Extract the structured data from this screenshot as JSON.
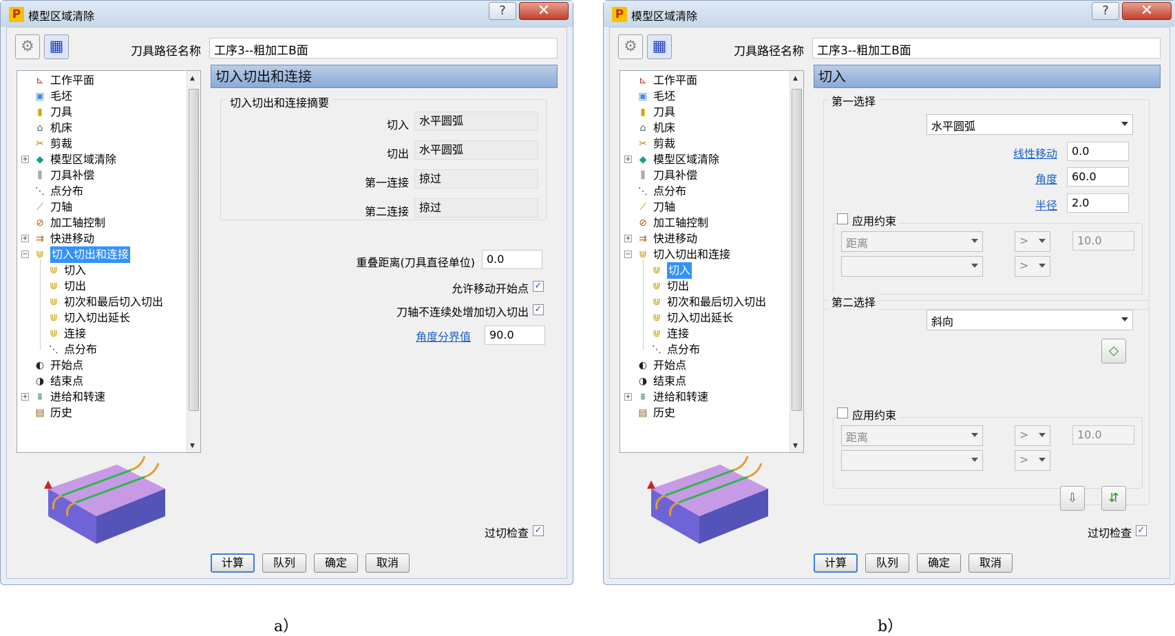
{
  "window_title": "模型区域清除",
  "app_icon": "P",
  "help_label": "?",
  "close_label": "✕",
  "path_label": "刀具路径名称",
  "path_value": "工序3--粗加工B面",
  "tree": {
    "items": [
      {
        "label": "工作平面",
        "icon": "workplane-icon"
      },
      {
        "label": "毛坯",
        "icon": "block-icon"
      },
      {
        "label": "刀具",
        "icon": "tool-icon"
      },
      {
        "label": "机床",
        "icon": "machine-icon"
      },
      {
        "label": "剪裁",
        "icon": "limit-icon"
      },
      {
        "label": "模型区域清除",
        "icon": "area-clearance-icon"
      },
      {
        "label": "刀具补偿",
        "icon": "tool-compensation-icon"
      },
      {
        "label": "点分布",
        "icon": "point-distribution-icon"
      },
      {
        "label": "刀轴",
        "icon": "tool-axis-icon"
      },
      {
        "label": "加工轴控制",
        "icon": "axis-control-icon"
      },
      {
        "label": "快进移动",
        "icon": "rapid-move-icon"
      },
      {
        "label": "切入切出和连接",
        "icon": "leads-links-icon"
      },
      {
        "label": "切入",
        "icon": "lead-in-icon"
      },
      {
        "label": "切出",
        "icon": "lead-out-icon"
      },
      {
        "label": "初次和最后切入切出",
        "icon": "first-last-leads-icon"
      },
      {
        "label": "切入切出延长",
        "icon": "lead-extension-icon"
      },
      {
        "label": "连接",
        "icon": "links-icon"
      },
      {
        "label": "点分布",
        "icon": "point-distribution-icon"
      },
      {
        "label": "开始点",
        "icon": "start-point-icon"
      },
      {
        "label": "结束点",
        "icon": "end-point-icon"
      },
      {
        "label": "进给和转速",
        "icon": "feeds-speeds-icon"
      },
      {
        "label": "历史",
        "icon": "history-icon"
      }
    ]
  },
  "buttons": {
    "calc": "计算",
    "queue": "队列",
    "ok": "确定",
    "cancel": "取消"
  },
  "gouge_check_label": "过切检查",
  "panel_a": {
    "header": "切入切出和连接",
    "summary_title": "切入切出和连接摘要",
    "summary": [
      {
        "label": "切入",
        "value": "水平圆弧"
      },
      {
        "label": "切出",
        "value": "水平圆弧"
      },
      {
        "label": "第一连接",
        "value": "掠过"
      },
      {
        "label": "第二连接",
        "value": "掠过"
      }
    ],
    "overlap_label": "重叠距离(刀具直径单位)",
    "overlap_value": "0.0",
    "allow_move_start_label": "允许移动开始点",
    "add_leads_label": "刀轴不连续处增加切入切出",
    "angle_threshold_label": "角度分界值",
    "angle_threshold_value": "90.0"
  },
  "panel_b": {
    "header": "切入",
    "first_choice_title": "第一选择",
    "first_choice_value": "水平圆弧",
    "linear_move_label": "线性移动",
    "linear_move_value": "0.0",
    "angle_label": "角度",
    "angle_value": "60.0",
    "radius_label": "半径",
    "radius_value": "2.0",
    "apply_constraint_label": "应用约束",
    "distance_label": "距离",
    "op_label": ">",
    "constraint_value": "10.0",
    "second_choice_title": "第二选择",
    "second_choice_value": "斜向"
  },
  "captions": {
    "a": "a）",
    "b": "b）"
  }
}
